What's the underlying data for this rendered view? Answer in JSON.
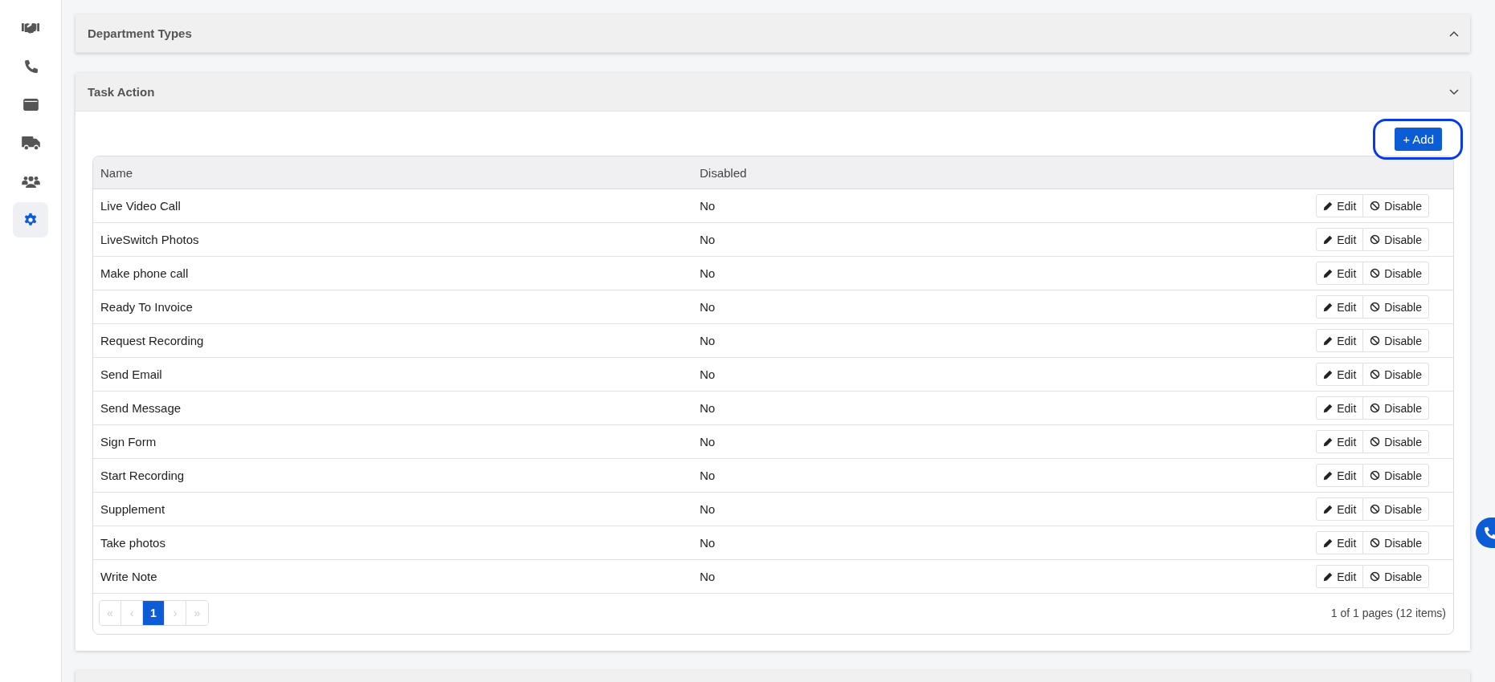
{
  "sidebar": {
    "items": [
      {
        "kind": "handshake",
        "selected": false
      },
      {
        "kind": "phone",
        "selected": false
      },
      {
        "kind": "wallet",
        "selected": false
      },
      {
        "kind": "truck",
        "selected": false
      },
      {
        "kind": "users",
        "selected": false
      },
      {
        "kind": "gear",
        "selected": true
      }
    ]
  },
  "panels": [
    {
      "title": "Department Types",
      "expanded": false
    },
    {
      "title": "Task Action",
      "expanded": true,
      "add_button": {
        "label": "+ Add",
        "highlighted": true
      },
      "table": {
        "columns": [
          "Name",
          "Disabled"
        ],
        "rows": [
          {
            "name": "Live Video Call",
            "disabled": "No",
            "edit": "Edit",
            "disable": "Disable"
          },
          {
            "name": "LiveSwitch Photos",
            "disabled": "No",
            "edit": "Edit",
            "disable": "Disable"
          },
          {
            "name": "Make phone call",
            "disabled": "No",
            "edit": "Edit",
            "disable": "Disable"
          },
          {
            "name": "Ready To Invoice",
            "disabled": "No",
            "edit": "Edit",
            "disable": "Disable"
          },
          {
            "name": "Request Recording",
            "disabled": "No",
            "edit": "Edit",
            "disable": "Disable"
          },
          {
            "name": "Send Email",
            "disabled": "No",
            "edit": "Edit",
            "disable": "Disable"
          },
          {
            "name": "Send Message",
            "disabled": "No",
            "edit": "Edit",
            "disable": "Disable"
          },
          {
            "name": "Sign Form",
            "disabled": "No",
            "edit": "Edit",
            "disable": "Disable"
          },
          {
            "name": "Start Recording",
            "disabled": "No",
            "edit": "Edit",
            "disable": "Disable"
          },
          {
            "name": "Supplement",
            "disabled": "No",
            "edit": "Edit",
            "disable": "Disable"
          },
          {
            "name": "Take photos",
            "disabled": "No",
            "edit": "Edit",
            "disable": "Disable"
          },
          {
            "name": "Write Note",
            "disabled": "No",
            "edit": "Edit",
            "disable": "Disable"
          }
        ]
      },
      "pager": {
        "pages": [
          {
            "label": "«",
            "selected": false,
            "disabled": true
          },
          {
            "label": "‹",
            "selected": false,
            "disabled": true
          },
          {
            "label": "1",
            "selected": true,
            "disabled": false
          },
          {
            "label": "›",
            "selected": false,
            "disabled": true
          },
          {
            "label": "»",
            "selected": false,
            "disabled": true
          }
        ],
        "summary": "1 of 1 pages (12 items)"
      }
    },
    {
      "expanded": false
    }
  ]
}
